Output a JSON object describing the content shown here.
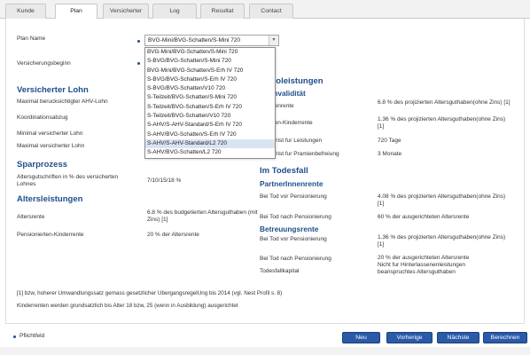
{
  "tabs": [
    "Kunde",
    "Plan",
    "Versicherter",
    "Log",
    "Resultat",
    "Contact"
  ],
  "active_tab": "Plan",
  "form": {
    "plan_name_label": "Plan Name",
    "plan_name_value": "BVG-Mini/BVG-Schatten/S-Mini 720",
    "versicherungsbeginn_label": "Versicherungsbeginn",
    "plan_options": [
      "BVG-Mini/BVG-Schatten/S-Mini 720",
      "S-BVG/BVG-Schatten/S-Mini 720",
      "BVG-Mini/BVG-Schatten/S-Erh IV 720",
      "S-BVG/BVG-Schatten/S-Erh IV 720",
      "S-BVG/BVG-Schatten/V10 720",
      "S-Teilzeit/BVG-Schatten/S-Mini 720",
      "S-Teilzeit/BVG-Schatten/S-Erh IV 720",
      "S-Teilzeit/BVG-Schatten/V10 720",
      "S-AHV/S-AHV-Standard/S-Erh IV 720",
      "S-AHV/BVG-Schatten/S-Erh IV 720",
      "S-AHV/S-AHV-Standard/L2 720",
      "S-AHV/BVG-Schatten/L2 720"
    ],
    "highlighted_option": "S-AHV/S-AHV-Standard/L2 720"
  },
  "left": {
    "versicherter_lohn_heading": "Versicherter Lohn",
    "max_ahv_label": "Maximal berucksichtigter AHV-Lohn",
    "koordinationsabzug_label": "Koordinationsabzug",
    "min_vers_lohn_label": "Minimal versicherter Lohn",
    "max_vers_lohn_label": "Maximal versicherter Lohn",
    "sparprozess_heading": "Sparprozess",
    "altersgutschriften_label": "Altersgutschriften in % des versicherten Lohnes",
    "altersgutschriften_value": "7/10/15/18 %",
    "altersleistungen_heading": "Altersleistungen",
    "altersrente_label": "Altersrente",
    "altersrente_value": "6.8 % des budgetierten Altersguthaben (mit Zins) [1]",
    "pens_kinder_label": "Pensionierten-Kinderrente",
    "pens_kinder_value": "20 % der Altersrente"
  },
  "right": {
    "risiko_heading": "koleistungen",
    "invaliditaet_heading": "Invalidität",
    "invalidenrente_label": "denrente",
    "invalidenrente_value": "6.8 % des projizierten Altersguthaben(ohne Zins) [1]",
    "inv_kinder_label": "den-Kinderrente",
    "inv_kinder_value": "1.36 % des projizierten Altersguthaben(ohne Zins) [1]",
    "wartefrist_leistungen_label": "efrist fur Leistungen",
    "wartefrist_leistungen_value": "720 Tage",
    "wartefrist_praemien_label": "efrist fur Pramienbefreiung",
    "wartefrist_praemien_value": "3 Monate",
    "todesfall_heading": "Im Todesfall",
    "partnerrente_heading": "PartnerInnenrente",
    "tod_vor_label": "Bei Tod vor Pensionierung",
    "tod_vor_value": "4.08 % des projizierten Altersguthaben(ohne Zins) [1]",
    "tod_nach_label": "Bei Tod nach Pensionierung",
    "tod_nach_value": "60 % der ausgerichteten Altersrente",
    "betreuungsrente_heading": "Betreuungsrente",
    "betr_vor_label": "Bei Tod vor Pensionierung",
    "betr_vor_value": "1.36 % des projizierten Altersguthaben(ohne Zins) [1]",
    "betr_nach_label": "Bei Tod nach Pensionierung",
    "betr_nach_value": "20 % der ausgerichteten Altersrente",
    "todesfallkapital_label": "Todesfallkapital",
    "todesfallkapital_value": "Nicht fur Hinterlassenenleistungen beanspruchtes Altersguthaben"
  },
  "footnotes": {
    "note1": "[1] bzw, hoherer Umwandlungssatz gemass gesetzlicher UbergangsregelUng bis 2014 (vgl. Nest Profil s. 8)",
    "note2": "Kinderrenten werden grundsatzlich bis Alter 18 bzw, 25 (wenn in Ausbildung) ausgerichtet"
  },
  "footer": {
    "pflichtfeld_label": "Pflichtfeld",
    "buttons": {
      "neu": "Neu",
      "vorherige": "Vorherige",
      "naechste": "Nächste",
      "berechnen": "Berechnen"
    }
  },
  "colors": {
    "heading": "#1f4e8c",
    "button": "#2a5aa8",
    "highlight": "#d9e4f1"
  }
}
